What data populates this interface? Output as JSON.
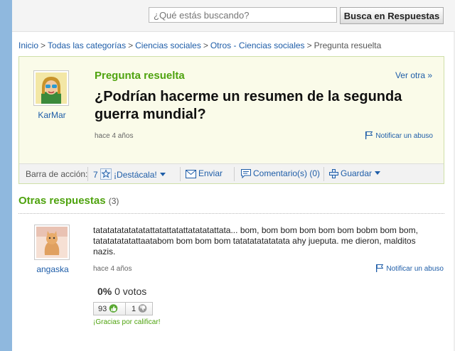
{
  "search": {
    "placeholder": "¿Qué estás buscando?",
    "button_label": "Busca en Respuestas"
  },
  "breadcrumb": [
    "Inicio",
    "Todas las categorías",
    "Ciencias sociales",
    "Otros - Ciencias sociales",
    "Pregunta resuelta"
  ],
  "breadcrumb_separator": ">",
  "question": {
    "user": "KarMar",
    "status": "Pregunta resuelta",
    "view_other": "Ver otra »",
    "title": "¿Podrían hacerme un resumen de la segunda guerra mundial?",
    "time": "hace 4 años",
    "report": "Notificar un abuso"
  },
  "action_bar": {
    "label": "Barra de acción:",
    "star_count": "7",
    "highlight": "¡Destácala!",
    "send": "Enviar",
    "comments": "Comentario(s) (0)",
    "save": "Guardar"
  },
  "other_answers": {
    "heading": "Otras respuestas",
    "count": "(3)"
  },
  "answer": {
    "user": "angaska",
    "text": "tatatatatatatatattatattatattatatatattata... bom, bom bom bom bom bom bobm bom bom, tatatatatatattaatabom bom bom bom tatatatatatatata ahy jueputa. me dieron, malditos nazis.",
    "time": "hace 4 años",
    "report": "Notificar un abuso",
    "percent": "0%",
    "votes": "0 votos",
    "thumbs_up": "93",
    "thumbs_down": "1",
    "thanks": "¡Gracias por calificar!"
  },
  "colors": {
    "accent_green": "#4fa30f",
    "link_blue": "#1e5da8",
    "left_bar": "#8fb8de"
  }
}
